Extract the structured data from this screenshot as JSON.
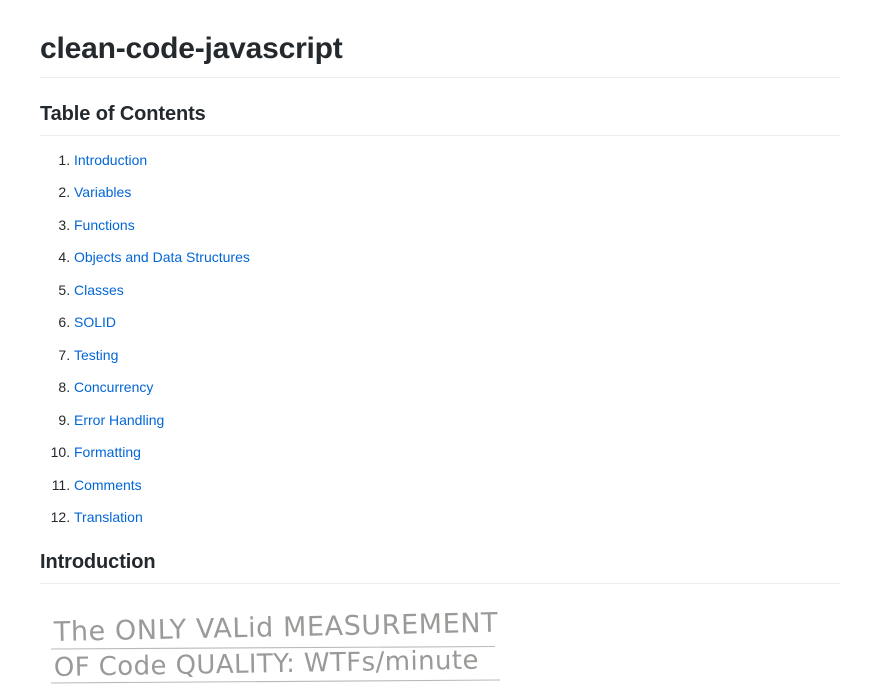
{
  "document": {
    "title": "clean-code-javascript",
    "sections": [
      {
        "id": "table-of-contents",
        "heading": "Table of Contents"
      },
      {
        "id": "introduction",
        "heading": "Introduction"
      }
    ]
  },
  "toc": {
    "heading": "Table of Contents",
    "items": [
      {
        "number": "1.",
        "label": "Introduction"
      },
      {
        "number": "2.",
        "label": "Variables"
      },
      {
        "number": "3.",
        "label": "Functions"
      },
      {
        "number": "4.",
        "label": "Objects and Data Structures"
      },
      {
        "number": "5.",
        "label": "Classes"
      },
      {
        "number": "6.",
        "label": "SOLID"
      },
      {
        "number": "7.",
        "label": "Testing"
      },
      {
        "number": "8.",
        "label": "Concurrency"
      },
      {
        "number": "9.",
        "label": "Error Handling"
      },
      {
        "number": "10.",
        "label": "Formatting"
      },
      {
        "number": "11.",
        "label": "Comments"
      },
      {
        "number": "12.",
        "label": "Translation"
      }
    ]
  },
  "introduction": {
    "heading": "Introduction",
    "figure": {
      "name": "humorous-quote-handwriting",
      "line1": "The ONLY VALid MEASUREMENT",
      "line2": "OF Code QUALITY: WTFs/minute"
    }
  },
  "colors": {
    "text": "#24292e",
    "link": "#0366d6",
    "rule": "#eaecef",
    "page_background": "#ffffff",
    "pencil": "#9a9a98"
  }
}
